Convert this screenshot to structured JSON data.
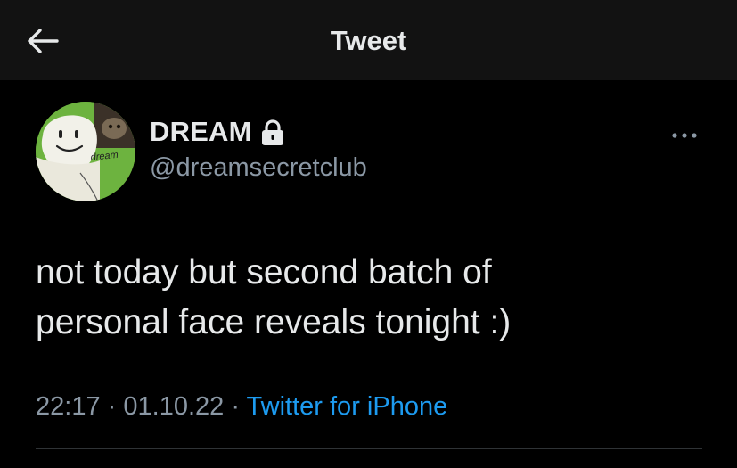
{
  "header": {
    "title": "Tweet",
    "back_icon": "arrow-left-icon"
  },
  "author": {
    "display_name": "DREAM",
    "handle": "@dreamsecretclub",
    "avatar_text": "dream",
    "verified_icon": "lock-icon"
  },
  "tweet": {
    "text": "not today but second batch of\npersonal face reveals tonight :)",
    "time": "22:17",
    "separator": "·",
    "date": "01.10.22",
    "source": "Twitter for iPhone"
  },
  "colors": {
    "background": "#000000",
    "header_background": "#121212",
    "text": "#e7e9ea",
    "secondary_text": "#8b98a5",
    "link": "#1d9bf0",
    "avatar_green": "#6db33f"
  }
}
